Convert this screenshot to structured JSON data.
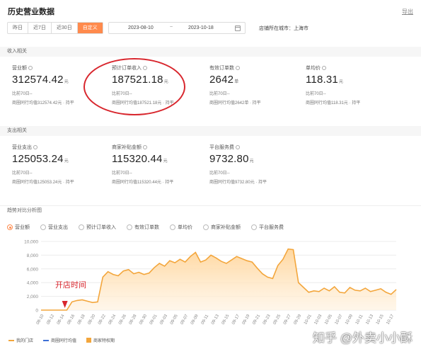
{
  "header": {
    "title": "历史营业数据",
    "export": "导出"
  },
  "filters": {
    "tabs": [
      "昨日",
      "近7日",
      "近30日",
      "自定义"
    ],
    "active_tab": "自定义",
    "date_start": "2023-08-10",
    "date_separator": "~",
    "date_end": "2023-10-18",
    "city": "店铺所在城市：上海市"
  },
  "income": {
    "label": "收入相关",
    "metrics": [
      {
        "title": "营业额",
        "value": "312574.42",
        "unit": "元",
        "compare": "比前70日--",
        "peer": "商圈同行均值312574.42元 · 持平"
      },
      {
        "title": "预计订单收入",
        "value": "187521.18",
        "unit": "元",
        "compare": "比前70日--",
        "peer": "商圈同行均值187521.18元 · 持平"
      },
      {
        "title": "有效订单数",
        "value": "2642",
        "unit": "单",
        "compare": "比前70日--",
        "peer": "商圈同行均值2642单 · 持平"
      },
      {
        "title": "单均价",
        "value": "118.31",
        "unit": "元",
        "compare": "比前70日--",
        "peer": "商圈同行均值118.31元 · 持平"
      }
    ]
  },
  "expense": {
    "label": "支出相关",
    "metrics": [
      {
        "title": "营业支出",
        "value": "125053.24",
        "unit": "元",
        "compare": "比前70日--",
        "peer": "商圈同行均值125053.24元 · 持平"
      },
      {
        "title": "商家补贴金额",
        "value": "115320.44",
        "unit": "元",
        "compare": "比前70日--",
        "peer": "商圈同行均值115320.44元 · 持平"
      },
      {
        "title": "平台服务费",
        "value": "9732.80",
        "unit": "元",
        "compare": "比前70日--",
        "peer": "商圈同行均值9732.80元 · 持平"
      }
    ]
  },
  "trend": {
    "label": "趋势对比分析图",
    "options": [
      "营业额",
      "营业支出",
      "预计订单收入",
      "有效订单数",
      "单均价",
      "商家补贴金额",
      "平台服务费"
    ],
    "selected": "营业额"
  },
  "annotation": {
    "open_label": "开店时间",
    "color": "#d8262d"
  },
  "colors": {
    "accent": "#ff8a4c",
    "area_top": "#ffd59a",
    "line": "#f3a63c",
    "peer_line": "#3d6fd6",
    "grid": "#ececec"
  },
  "chart_data": {
    "type": "area",
    "ylim": [
      0,
      10000
    ],
    "yticks": [
      0,
      2000,
      4000,
      6000,
      8000,
      10000
    ],
    "ytick_labels": [
      "0",
      "2,000",
      "4,000",
      "6,000",
      "8,000",
      "10,000"
    ],
    "x": [
      "08-10",
      "08-11",
      "08-12",
      "08-13",
      "08-14",
      "08-15",
      "08-16",
      "08-17",
      "08-18",
      "08-19",
      "08-20",
      "08-21",
      "08-22",
      "08-23",
      "08-24",
      "08-25",
      "08-26",
      "08-27",
      "08-28",
      "08-29",
      "08-30",
      "08-31",
      "09-01",
      "09-02",
      "09-03",
      "09-04",
      "09-05",
      "09-06",
      "09-07",
      "09-08",
      "09-09",
      "09-10",
      "09-11",
      "09-12",
      "09-13",
      "09-14",
      "09-15",
      "09-16",
      "09-17",
      "09-18",
      "09-19",
      "09-20",
      "09-21",
      "09-22",
      "09-23",
      "09-24",
      "09-25",
      "09-26",
      "09-27",
      "09-28",
      "09-29",
      "09-30",
      "10-01",
      "10-02",
      "10-03",
      "10-04",
      "10-05",
      "10-06",
      "10-07",
      "10-08",
      "10-09",
      "10-10",
      "10-11",
      "10-12",
      "10-13",
      "10-14",
      "10-15",
      "10-16",
      "10-17",
      "10-18"
    ],
    "xtick_labels": [
      "08-10",
      "08-12",
      "08-14",
      "08-16",
      "08-18",
      "08-20",
      "08-22",
      "08-24",
      "08-26",
      "08-28",
      "08-30",
      "09-01",
      "09-03",
      "09-05",
      "09-07",
      "09-09",
      "09-11",
      "09-13",
      "09-15",
      "09-17",
      "09-19",
      "09-21",
      "09-23",
      "09-25",
      "09-27",
      "09-29",
      "10-01",
      "10-03",
      "10-05",
      "10-07",
      "10-09",
      "10-11",
      "10-13",
      "10-15",
      "10-17"
    ],
    "series": [
      {
        "name": "我的门店",
        "values": [
          0,
          0,
          0,
          0,
          0,
          0,
          1200,
          1400,
          1500,
          1300,
          1100,
          1200,
          4800,
          5600,
          5200,
          5000,
          5700,
          5900,
          5300,
          5500,
          5200,
          5400,
          6200,
          6800,
          6400,
          7200,
          6900,
          7400,
          7000,
          7800,
          8400,
          7000,
          7300,
          8000,
          7600,
          7100,
          6800,
          7300,
          7800,
          7500,
          7200,
          7000,
          6100,
          5300,
          4800,
          4600,
          6500,
          7400,
          8900,
          8800,
          4000,
          3300,
          2600,
          2800,
          2700,
          3200,
          2800,
          3400,
          2600,
          2500,
          3300,
          2900,
          2800,
          3200,
          2700,
          2900,
          3100,
          2600,
          2300,
          3000
        ]
      },
      {
        "name": "商圈同行均值",
        "values": []
      },
      {
        "name": "商家特权期",
        "values": []
      }
    ]
  },
  "watermark": "知乎 @外卖小小酥"
}
